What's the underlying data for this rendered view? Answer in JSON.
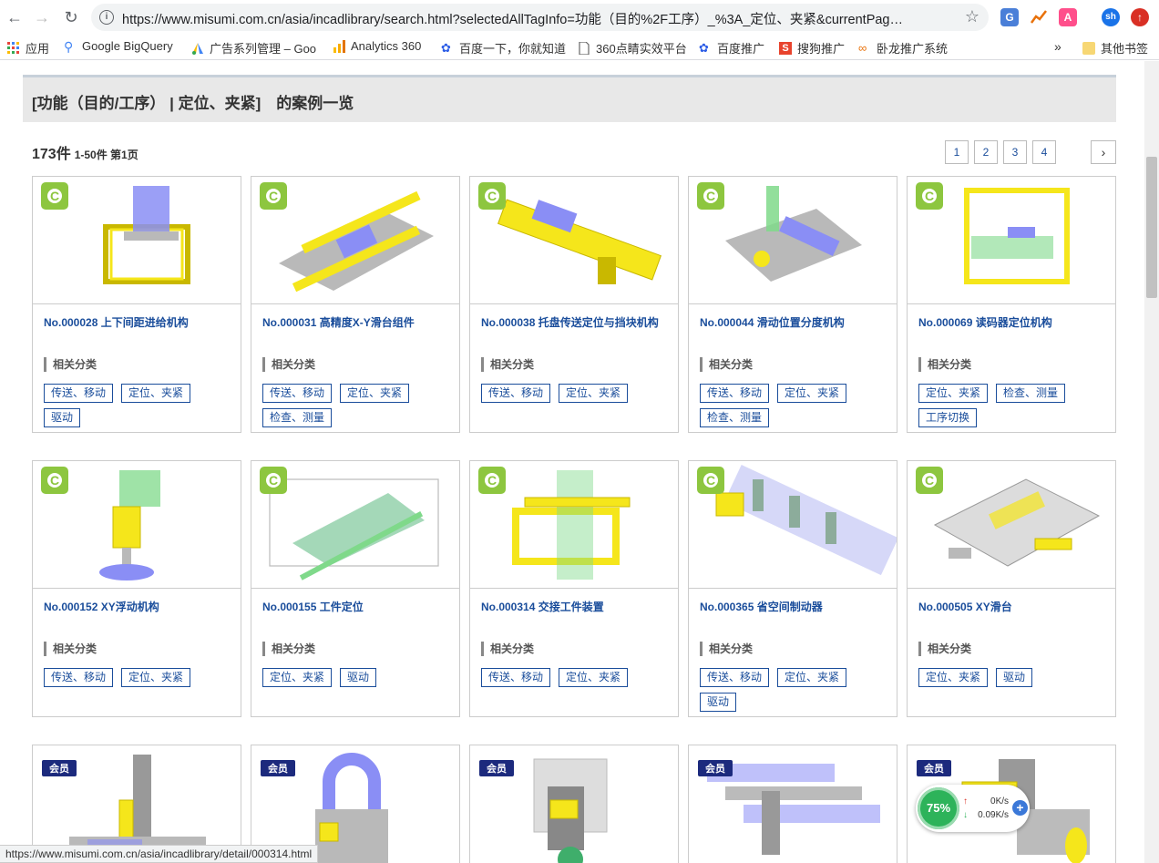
{
  "browser": {
    "url": "https://www.misumi.com.cn/asia/incadlibrary/search.html?selectedAllTagInfo=功能（目的%2F工序）_%3A_定位、夹紧&currentPag…",
    "bookmarks": [
      "应用",
      "Google BigQuery",
      "广告系列管理 – Goo",
      "Analytics 360",
      "百度一下，你就知道",
      "360点睛实效平台",
      "百度推广",
      "搜狗推广",
      "卧龙推广系统"
    ],
    "other_bookmarks": "其他书签",
    "more_bookmarks": "»",
    "profile_initials": "sh",
    "ext_a_label": "A"
  },
  "page": {
    "heading": "[功能（目的/工序） | 定位、夹紧]　的案例一览",
    "total_count": "173件",
    "range_info": "1-50件 第1页",
    "pages": [
      "1",
      "2",
      "3",
      "4"
    ],
    "next_label": "›",
    "related_label": "相关分类",
    "member_label": "会员",
    "c_badge_letter": "C"
  },
  "cards": [
    {
      "title": "No.000028 上下间距进给机构",
      "tags": [
        "传送、移动",
        "定位、夹紧",
        "驱动"
      ]
    },
    {
      "title": "No.000031 高精度X-Y滑台组件",
      "tags": [
        "传送、移动",
        "定位、夹紧",
        "检查、测量"
      ]
    },
    {
      "title": "No.000038 托盘传送定位与挡块机构",
      "tags": [
        "传送、移动",
        "定位、夹紧"
      ]
    },
    {
      "title": "No.000044 滑动位置分度机构",
      "tags": [
        "传送、移动",
        "定位、夹紧",
        "检查、测量"
      ]
    },
    {
      "title": "No.000069 读码器定位机构",
      "tags": [
        "定位、夹紧",
        "检查、测量",
        "工序切换"
      ]
    },
    {
      "title": "No.000152 XY浮动机构",
      "tags": [
        "传送、移动",
        "定位、夹紧"
      ]
    },
    {
      "title": "No.000155 工件定位",
      "tags": [
        "定位、夹紧",
        "驱动"
      ]
    },
    {
      "title": "No.000314 交接工件装置",
      "tags": [
        "传送、移动",
        "定位、夹紧"
      ]
    },
    {
      "title": "No.000365 省空间制动器",
      "tags": [
        "传送、移动",
        "定位、夹紧",
        "驱动"
      ]
    },
    {
      "title": "No.000505 XY滑台",
      "tags": [
        "定位、夹紧",
        "驱动"
      ]
    }
  ],
  "status_bar": "https://www.misumi.com.cn/asia/incadlibrary/detail/000314.html",
  "speed_widget": {
    "percent": "75%",
    "up": "0K/s",
    "down": "0.09K/s"
  },
  "colors": {
    "link": "#1a4d9b",
    "badge_green": "#8dc63f",
    "member_navy": "#1c2a7d",
    "machine_yellow": "#f5e61b",
    "part_blue": "#7b7ff0"
  }
}
